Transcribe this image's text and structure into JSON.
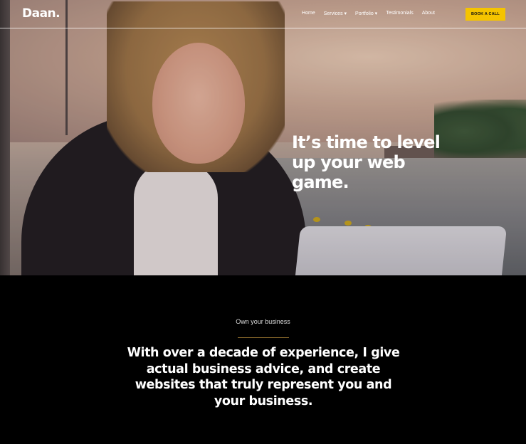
{
  "nav": {
    "logo": "Daan.",
    "items": [
      {
        "label": "Home"
      },
      {
        "label": "Services ▾"
      },
      {
        "label": "Portfolio ▾"
      },
      {
        "label": "Testimonials"
      },
      {
        "label": "About"
      }
    ],
    "cta_label": "BOOK A CALL"
  },
  "hero": {
    "headline": "It’s time to level up your web game."
  },
  "intro": {
    "eyebrow": "Own your business",
    "statement": "With over a decade of experience, I give actual business advice, and create websites that truly represent you and your business."
  },
  "colors": {
    "accent": "#f5c400",
    "background": "#000000",
    "divider": "#8a6a2c"
  }
}
